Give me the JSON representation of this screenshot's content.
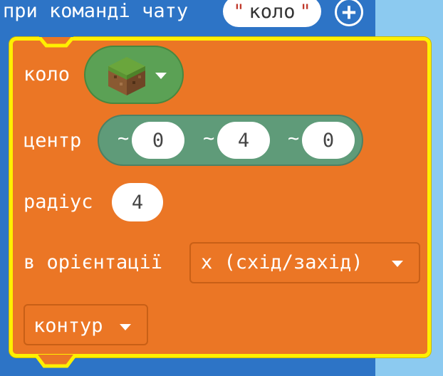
{
  "hat": {
    "label": "при команді чату",
    "command_value": "коло",
    "quote_open": "\"",
    "quote_close": "\"",
    "add_icon": "plus-circle-icon"
  },
  "block": {
    "shape_label": "коло",
    "block_icon": "grass-block-icon",
    "center_label": "центр",
    "center": {
      "x_prefix": "~",
      "x": "0",
      "y_prefix": "~",
      "y": "4",
      "z_prefix": "~",
      "z": "0"
    },
    "radius_label": "радіус",
    "radius": "4",
    "orientation_label": "в орієнтації",
    "orientation_value": "x (схід/захід)",
    "fill_mode_value": "контур"
  },
  "colors": {
    "hat_bg": "#2d74c6",
    "block_bg": "#eb7625",
    "block_outline": "#fff000",
    "block_dropdown_bg": "#5ba155",
    "position_bg": "#5f9b79",
    "background": "#8ccaf0"
  }
}
